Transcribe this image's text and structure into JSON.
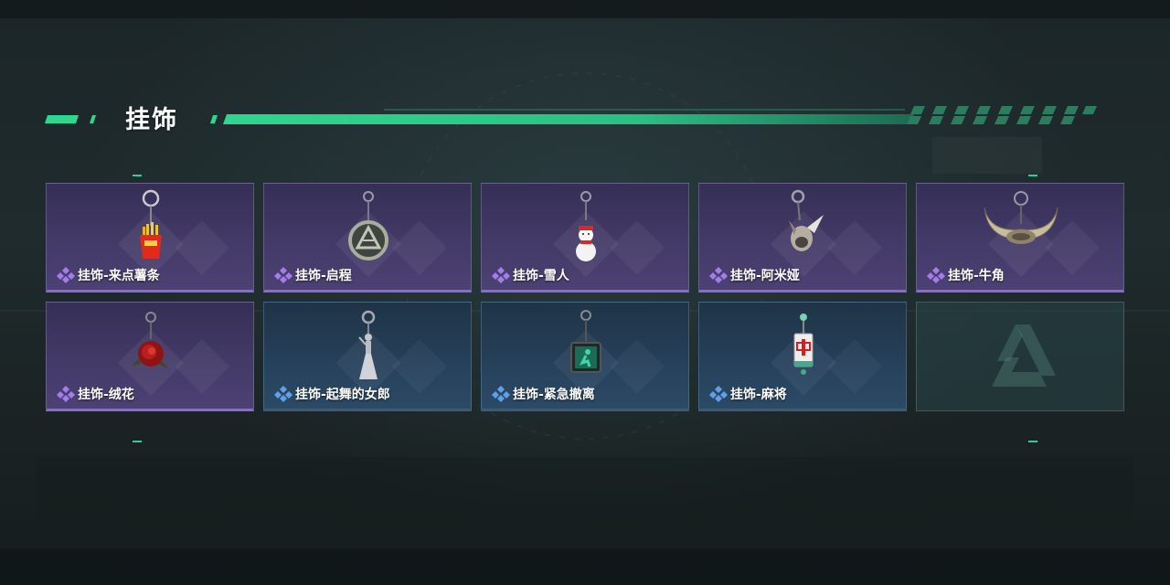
{
  "header": {
    "title": "挂饰"
  },
  "colors": {
    "accent": "#2fd68f",
    "rarity_purple": "#8b68d9",
    "rarity_blue": "#4f8fd8"
  },
  "items": [
    {
      "name": "挂饰-来点薯条",
      "rarity": "purple",
      "icon": "fries-charm-icon"
    },
    {
      "name": "挂饰-启程",
      "rarity": "purple",
      "icon": "medallion-charm-icon"
    },
    {
      "name": "挂饰-雪人",
      "rarity": "purple",
      "icon": "snowman-charm-icon"
    },
    {
      "name": "挂饰-阿米娅",
      "rarity": "purple",
      "icon": "amiya-charm-icon"
    },
    {
      "name": "挂饰-牛角",
      "rarity": "purple",
      "icon": "horns-charm-icon"
    },
    {
      "name": "挂饰-绒花",
      "rarity": "purple",
      "icon": "rose-charm-icon"
    },
    {
      "name": "挂饰-起舞的女郎",
      "rarity": "blue",
      "icon": "dancer-charm-icon"
    },
    {
      "name": "挂饰-紧急撤离",
      "rarity": "blue",
      "icon": "evacuation-charm-icon"
    },
    {
      "name": "挂饰-麻将",
      "rarity": "blue",
      "icon": "mahjong-charm-icon"
    }
  ],
  "empty_slot": {
    "icon": "game-logo-icon"
  }
}
